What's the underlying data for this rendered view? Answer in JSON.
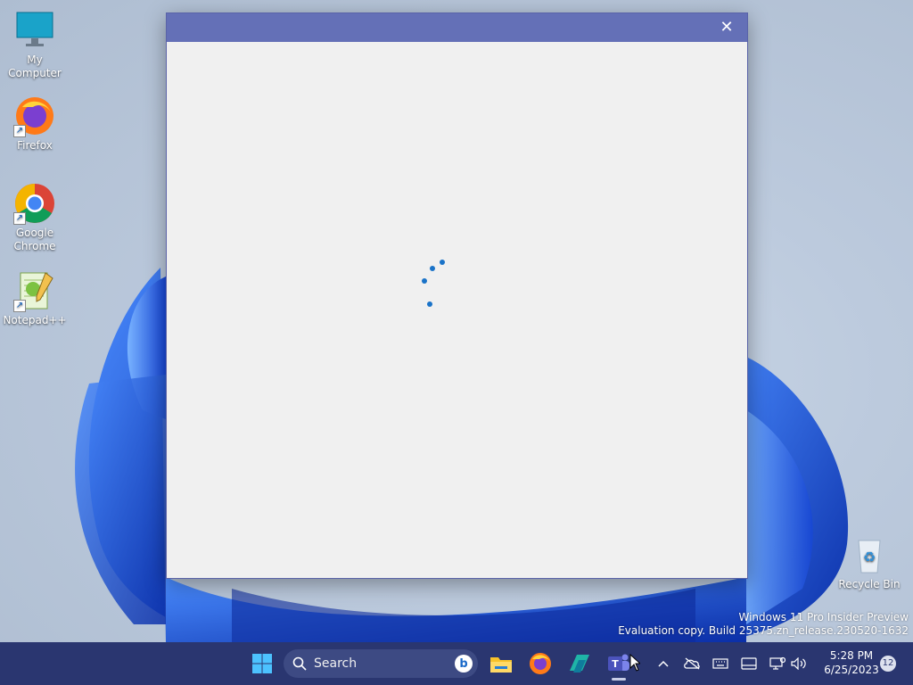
{
  "desktop": {
    "icons": [
      {
        "label": "My Computer",
        "icon": "monitor-icon"
      },
      {
        "label": "Firefox",
        "icon": "firefox-icon"
      },
      {
        "label": "Google Chrome",
        "icon": "chrome-icon"
      },
      {
        "label": "Notepad++",
        "icon": "notepadpp-icon"
      },
      {
        "label": "Recycle Bin",
        "icon": "recycle-bin-icon"
      }
    ],
    "watermark": {
      "line1": "Windows 11 Pro Insider Preview",
      "line2": "Evaluation copy. Build 25375.zn_release.230520-1632"
    }
  },
  "window": {
    "titlebar_color": "#6470b7",
    "close_glyph": "✕",
    "content": "loading-spinner"
  },
  "taskbar": {
    "search_placeholder": "Search",
    "pinned": [
      "start-icon",
      "file-explorer-icon",
      "firefox-icon",
      "app-icon",
      "teams-icon"
    ],
    "tray": [
      "chevron-up-icon",
      "onedrive-off-icon",
      "keyboard-icon",
      "tablet-icon",
      "network-icon",
      "volume-icon"
    ],
    "clock": {
      "time": "5:28 PM",
      "date": "6/25/2023"
    },
    "notification_count": "12"
  }
}
